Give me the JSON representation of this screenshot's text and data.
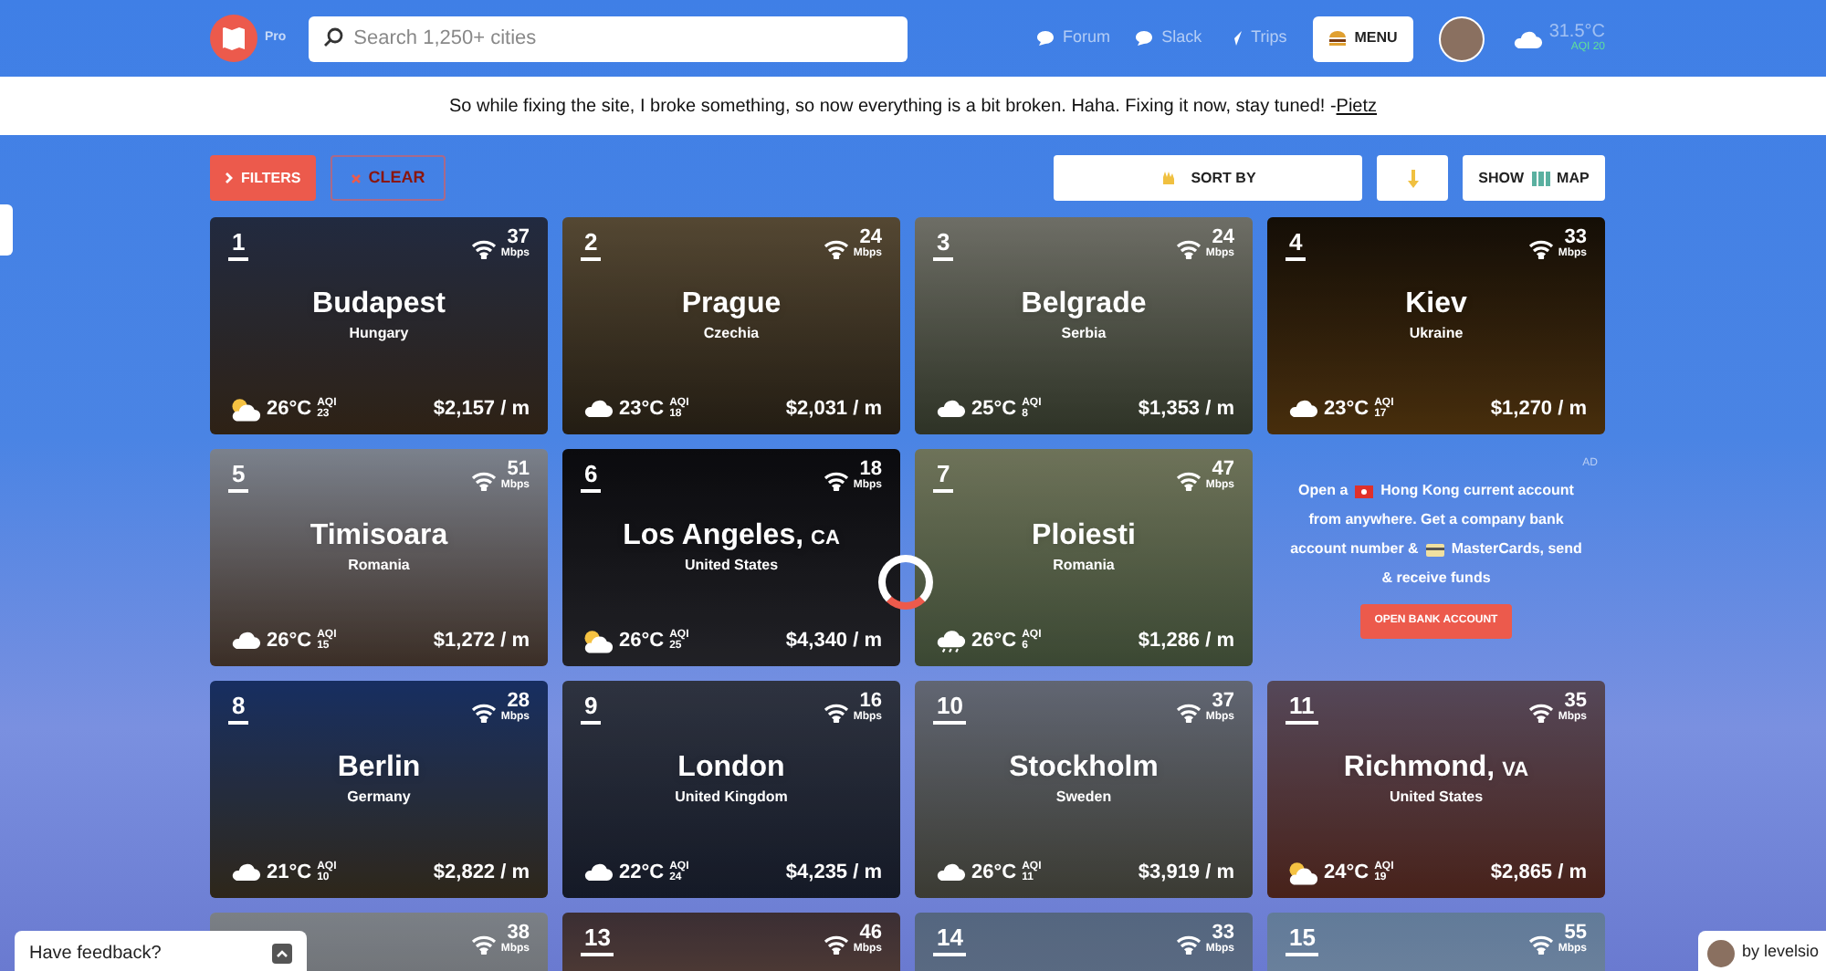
{
  "header": {
    "badge": "Pro",
    "search": {
      "placeholder": "Search 1,250+ cities"
    },
    "nav": [
      {
        "label": "Forum",
        "kind": "chat"
      },
      {
        "label": "Slack",
        "kind": "chat"
      },
      {
        "label": "Trips",
        "kind": "plane"
      }
    ],
    "menu": "MENU",
    "weather": {
      "temp": "31.5°C",
      "aqi": "AQI 20"
    }
  },
  "announcement": {
    "text": "So while fixing the site, I broke something, so now everything is a bit broken. Haha. Fixing it now, stay tuned! -",
    "link": "Pietz"
  },
  "toolbar": {
    "filters": "FILTERS",
    "clear": "CLEAR",
    "sort": "SORT BY",
    "show_before": "SHOW",
    "show_after": "MAP"
  },
  "cities": [
    {
      "rank": "1",
      "speed": "37",
      "unit": "Mbps",
      "name": "Budapest",
      "country": "Hungary",
      "weather": {
        "kind": "sun_cloud"
      },
      "temp": "26°C",
      "aqi_label": "AQI",
      "aqi": "23",
      "cost": "$2,157 / m"
    },
    {
      "rank": "2",
      "speed": "24",
      "unit": "Mbps",
      "name": "Prague",
      "country": "Czechia",
      "weather": {
        "kind": "cloud"
      },
      "temp": "23°C",
      "aqi_label": "AQI",
      "aqi": "18",
      "cost": "$2,031 / m"
    },
    {
      "rank": "3",
      "speed": "24",
      "unit": "Mbps",
      "name": "Belgrade",
      "country": "Serbia",
      "weather": {
        "kind": "cloud"
      },
      "temp": "25°C",
      "aqi_label": "AQI",
      "aqi": "8",
      "cost": "$1,353 / m"
    },
    {
      "rank": "4",
      "speed": "33",
      "unit": "Mbps",
      "name": "Kiev",
      "country": "Ukraine",
      "weather": {
        "kind": "cloud"
      },
      "temp": "23°C",
      "aqi_label": "AQI",
      "aqi": "17",
      "cost": "$1,270 / m"
    },
    {
      "rank": "5",
      "speed": "51",
      "unit": "Mbps",
      "name": "Timisoara",
      "country": "Romania",
      "weather": {
        "kind": "cloud"
      },
      "temp": "26°C",
      "aqi_label": "AQI",
      "aqi": "15",
      "cost": "$1,272 / m"
    },
    {
      "rank": "6",
      "speed": "18",
      "unit": "Mbps",
      "name": "Los Angeles,",
      "region": "CA",
      "country": "United States",
      "weather": {
        "kind": "sun_cloud"
      },
      "temp": "26°C",
      "aqi_label": "AQI",
      "aqi": "25",
      "cost": "$4,340 / m"
    },
    {
      "rank": "7",
      "speed": "47",
      "unit": "Mbps",
      "name": "Ploiesti",
      "country": "Romania",
      "weather": {
        "kind": "rain"
      },
      "temp": "26°C",
      "aqi_label": "AQI",
      "aqi": "6",
      "cost": "$1,286 / m"
    },
    {
      "kind": "ad",
      "label": "AD",
      "lines": [
        [
          "Open a",
          "Hong Kong current account"
        ],
        [
          "from anywhere. Get a company bank"
        ],
        [
          "account number &",
          "MasterCards, send"
        ],
        [
          "& receive funds"
        ]
      ],
      "button": "OPEN BANK ACCOUNT"
    },
    {
      "rank": "8",
      "speed": "28",
      "unit": "Mbps",
      "name": "Berlin",
      "country": "Germany",
      "weather": {
        "kind": "cloud"
      },
      "temp": "21°C",
      "aqi_label": "AQI",
      "aqi": "10",
      "cost": "$2,822 / m"
    },
    {
      "rank": "9",
      "speed": "16",
      "unit": "Mbps",
      "name": "London",
      "country": "United Kingdom",
      "weather": {
        "kind": "cloud"
      },
      "temp": "22°C",
      "aqi_label": "AQI",
      "aqi": "24",
      "cost": "$4,235 / m"
    },
    {
      "rank": "10",
      "speed": "37",
      "unit": "Mbps",
      "name": "Stockholm",
      "country": "Sweden",
      "weather": {
        "kind": "cloud"
      },
      "temp": "26°C",
      "aqi_label": "AQI",
      "aqi": "11",
      "cost": "$3,919 / m"
    },
    {
      "rank": "11",
      "speed": "35",
      "unit": "Mbps",
      "name": "Richmond,",
      "region": "VA",
      "country": "United States",
      "weather": {
        "kind": "sun_cloud"
      },
      "temp": "24°C",
      "aqi_label": "AQI",
      "aqi": "19",
      "cost": "$2,865 / m"
    },
    {
      "speed": "38",
      "unit": "Mbps"
    },
    {
      "rank": "13",
      "speed": "46",
      "unit": "Mbps"
    },
    {
      "rank": "14",
      "speed": "33",
      "unit": "Mbps"
    },
    {
      "rank": "15",
      "speed": "55",
      "unit": "Mbps"
    }
  ],
  "feedback": "Have feedback?",
  "credit": "by levelsio"
}
